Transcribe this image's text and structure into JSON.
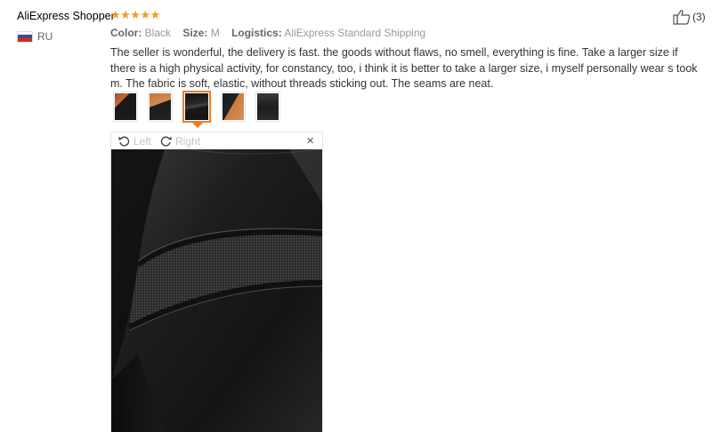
{
  "reviewer": {
    "name": "AliExpress Shopper",
    "rating": 5,
    "stars": "★★★★★",
    "country": "RU"
  },
  "meta": {
    "color_label": "Color:",
    "color_value": "Black",
    "size_label": "Size:",
    "size_value": "M",
    "logistics_label": "Logistics:",
    "logistics_value": "AliExpress Standard Shipping"
  },
  "review": {
    "text": "The seller is wonderful, the delivery is fast. the goods without flaws, no smell, everything is fine. Take a larger size if there is a high physical activity, for constancy, too, i think it is better to take a larger size, i myself personally wear s took m. The fabric is soft, elastic, without threads sticking out. The seams are neat."
  },
  "helpful": {
    "count": "(3)"
  },
  "thumbnails": {
    "count": 5,
    "selected_index": 2
  },
  "viewer": {
    "left_label": "Left",
    "right_label": "Right",
    "close_glyph": "×"
  },
  "colors": {
    "star": "#f59a23",
    "accent": "#f47a20",
    "text": "#333333",
    "muted": "#999999"
  },
  "icons": {
    "helpful": "thumbs-up-icon",
    "rotate_left": "rotate-left-icon",
    "rotate_right": "rotate-right-icon",
    "close": "close-icon",
    "flag": "russia-flag-icon"
  }
}
